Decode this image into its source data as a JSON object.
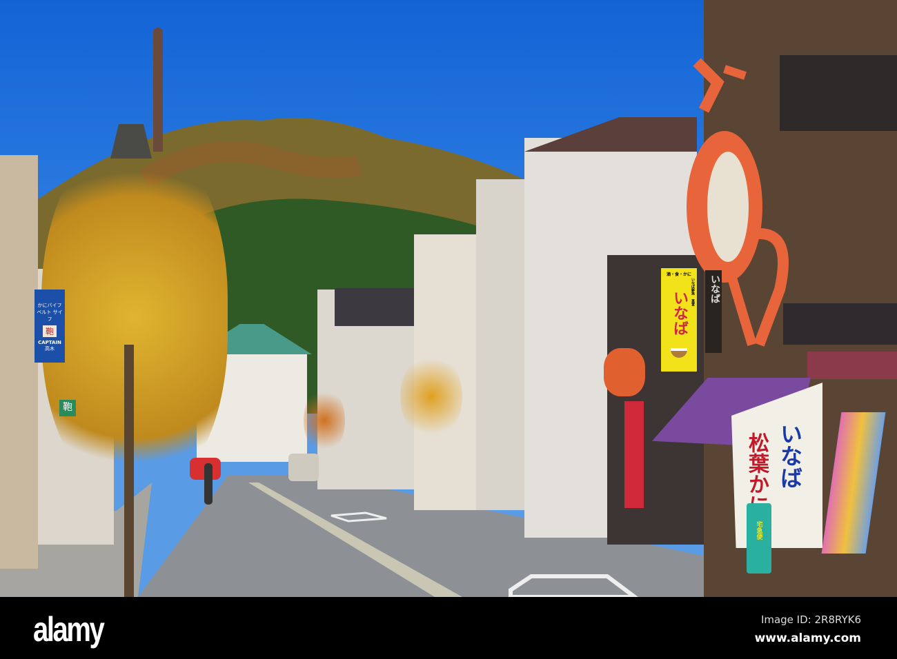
{
  "photo": {
    "description_tags": [
      "street",
      "crab-sign",
      "mountain",
      "autumn-trees"
    ],
    "colors": {
      "sky": "#1463d6",
      "crab": "#e8643a",
      "awning": "#7a4a9e",
      "sign_yellow": "#f2e21a"
    }
  },
  "signs": {
    "yellow_top": "酒・食・かに",
    "yellow_main": "いなば",
    "yellow_sub": "いなば鮮魚 直営",
    "dark_vertical": "いなば",
    "banner_blue": "いなば",
    "banner_red": "松葉かに",
    "delivery": "宅急便",
    "left_blue_top": "かにバイフ ベルト サイフ",
    "left_blue_kanji": "鞄",
    "left_blue_brand": "CAPTAIN",
    "left_blue_name": "高木",
    "left_small": "鞄"
  },
  "watermark": {
    "logo": "alamy",
    "image_id": "Image ID: 2R8RYK6",
    "site": "www.alamy.com"
  }
}
